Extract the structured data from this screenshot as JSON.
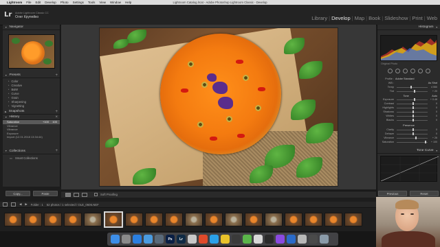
{
  "menubar": {
    "app_name": "Lightroom",
    "items": [
      "File",
      "Edit",
      "Develop",
      "Photo",
      "Settings",
      "Tools",
      "View",
      "Window",
      "Help"
    ],
    "window_title": "Lightroom Catalog.lrcat - Adobe Photoshop Lightroom Classic - Develop"
  },
  "identity": {
    "logo": "Lr",
    "product": "Adobe Lightroom Classic CC",
    "user": "Олег Крупейко"
  },
  "modules": [
    "Library",
    "Develop",
    "Map",
    "Book",
    "Slideshow",
    "Print",
    "Web"
  ],
  "active_module": "Develop",
  "left_panel": {
    "navigator": "Navigator",
    "presets": "Presets",
    "preset_groups": [
      "Color",
      "Creative",
      "B&W",
      "Curve",
      "Grain",
      "Sharpening",
      "Vignetting"
    ],
    "snapshots": "Snapshots",
    "history": "History",
    "history_items": [
      {
        "label": "Saturation",
        "v1": "+100",
        "v2": "100",
        "selected": true
      },
      {
        "label": "Vibrance",
        "v1": "",
        "v2": "",
        "selected": false
      },
      {
        "label": "Vibrance",
        "v1": "",
        "v2": "",
        "selected": false
      },
      {
        "label": "Exposure",
        "v1": "",
        "v2": "",
        "selected": false
      },
      {
        "label": "Import (12.01.2018 13:34:44)",
        "v1": "",
        "v2": "",
        "selected": false
      }
    ],
    "collections": "Collections",
    "collection_item": "Smart Collections",
    "copy_button": "Copy...",
    "paste_button": "Paste"
  },
  "toolbar": {
    "soft_proofing": "Soft Proofing"
  },
  "filmstrip_bar": {
    "folder": "Folder : 1",
    "count": "52 photos / 1 selected / OLE_0606.NEF"
  },
  "right_panel": {
    "histogram": "Histogram",
    "original_photo": "Original Photo",
    "profile_label": "Profile :",
    "profile_value": "Adobe Standard",
    "wb_label": "WB :",
    "wb_value": "As Shot",
    "tone": "Tone",
    "tone_auto": "Auto",
    "presence": "Presence",
    "tone_curve": "Tone Curve",
    "prev_button": "Previous",
    "reset_button": "Reset",
    "sliders_wb": [
      {
        "label": "Temp",
        "value": "4 550",
        "pos": 0.45
      },
      {
        "label": "Tint",
        "value": "+ 20",
        "pos": 0.55
      }
    ],
    "sliders_tone": [
      {
        "label": "Exposure",
        "value": "+ 0.48",
        "pos": 0.55
      },
      {
        "label": "Contrast",
        "value": "0",
        "pos": 0.5
      },
      {
        "label": "Highlights",
        "value": "0",
        "pos": 0.5
      },
      {
        "label": "Shadows",
        "value": "0",
        "pos": 0.5
      },
      {
        "label": "Whites",
        "value": "0",
        "pos": 0.5
      },
      {
        "label": "Blacks",
        "value": "0",
        "pos": 0.5
      }
    ],
    "sliders_presence": [
      {
        "label": "Clarity",
        "value": "0",
        "pos": 0.5
      },
      {
        "label": "Dehaze",
        "value": "0",
        "pos": 0.5
      },
      {
        "label": "Vibrance",
        "value": "+ 26",
        "pos": 0.6
      },
      {
        "label": "Saturation",
        "value": "+ 100",
        "pos": 0.9
      }
    ]
  },
  "dock": {
    "icons": [
      {
        "name": "finder-icon",
        "color": "#3d8ee8",
        "glyph": ""
      },
      {
        "name": "launchpad-icon",
        "color": "#8a8a8a",
        "glyph": ""
      },
      {
        "name": "safari-icon",
        "color": "#2a7fe0",
        "glyph": ""
      },
      {
        "name": "mail-icon",
        "color": "#4a9be0",
        "glyph": ""
      },
      {
        "name": "finder-folder-icon",
        "color": "#5a6a7a",
        "glyph": ""
      },
      {
        "name": "photoshop-icon",
        "color": "#0a1f44",
        "glyph": "Ps"
      },
      {
        "name": "lightroom-icon",
        "color": "#0f2a44",
        "glyph": "Lr"
      },
      {
        "name": "app-icon",
        "color": "#c8c8c8",
        "glyph": ""
      },
      {
        "name": "chrome-icon",
        "color": "#e04a2a",
        "glyph": ""
      },
      {
        "name": "skype-icon",
        "color": "#2aa0e8",
        "glyph": ""
      },
      {
        "name": "app-icon-2",
        "color": "#e8c22a",
        "glyph": ""
      },
      {
        "name": "app-icon-3",
        "color": "#3a3a3a",
        "glyph": ""
      },
      {
        "name": "app-icon-4",
        "color": "#5ab54a",
        "glyph": ""
      },
      {
        "name": "app-icon-5",
        "color": "#d8d8d8",
        "glyph": ""
      },
      {
        "name": "app-icon-6",
        "color": "#2a2a2a",
        "glyph": ""
      },
      {
        "name": "app-icon-7",
        "color": "#8a4ae0",
        "glyph": ""
      },
      {
        "name": "app-icon-8",
        "color": "#2a6ac8",
        "glyph": ""
      },
      {
        "name": "app-icon-9",
        "color": "#b8b8b8",
        "glyph": ""
      },
      {
        "name": "app-icon-10",
        "color": "#4a4a4a",
        "glyph": ""
      },
      {
        "name": "trash-icon",
        "color": "#8a9aa8",
        "glyph": ""
      }
    ]
  }
}
